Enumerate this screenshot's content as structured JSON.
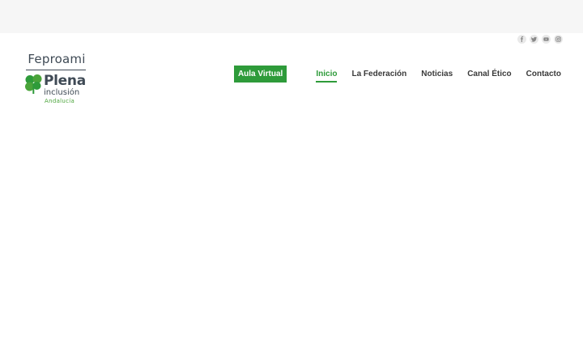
{
  "site": {
    "brand": "Feproami",
    "logo_main": "Plena",
    "logo_sub": "inclusión",
    "logo_region": "Andalucía"
  },
  "social": [
    {
      "icon": "facebook-icon",
      "glyph": "f"
    },
    {
      "icon": "twitter-icon",
      "glyph": "t"
    },
    {
      "icon": "youtube-icon",
      "glyph": "y"
    },
    {
      "icon": "instagram-icon",
      "glyph": "i"
    }
  ],
  "nav": {
    "cta": "Aula Virtual",
    "items": [
      {
        "label": "Inicio",
        "active": true
      },
      {
        "label": "La Federación",
        "active": false
      },
      {
        "label": "Noticias",
        "active": false
      },
      {
        "label": "Canal Ético",
        "active": false
      },
      {
        "label": "Contacto",
        "active": false
      }
    ]
  },
  "colors": {
    "accent": "#2e9b3a",
    "topbar": "#f6f6f6",
    "logo_text": "#3f4a55",
    "logo_green": "#4aa43a"
  }
}
